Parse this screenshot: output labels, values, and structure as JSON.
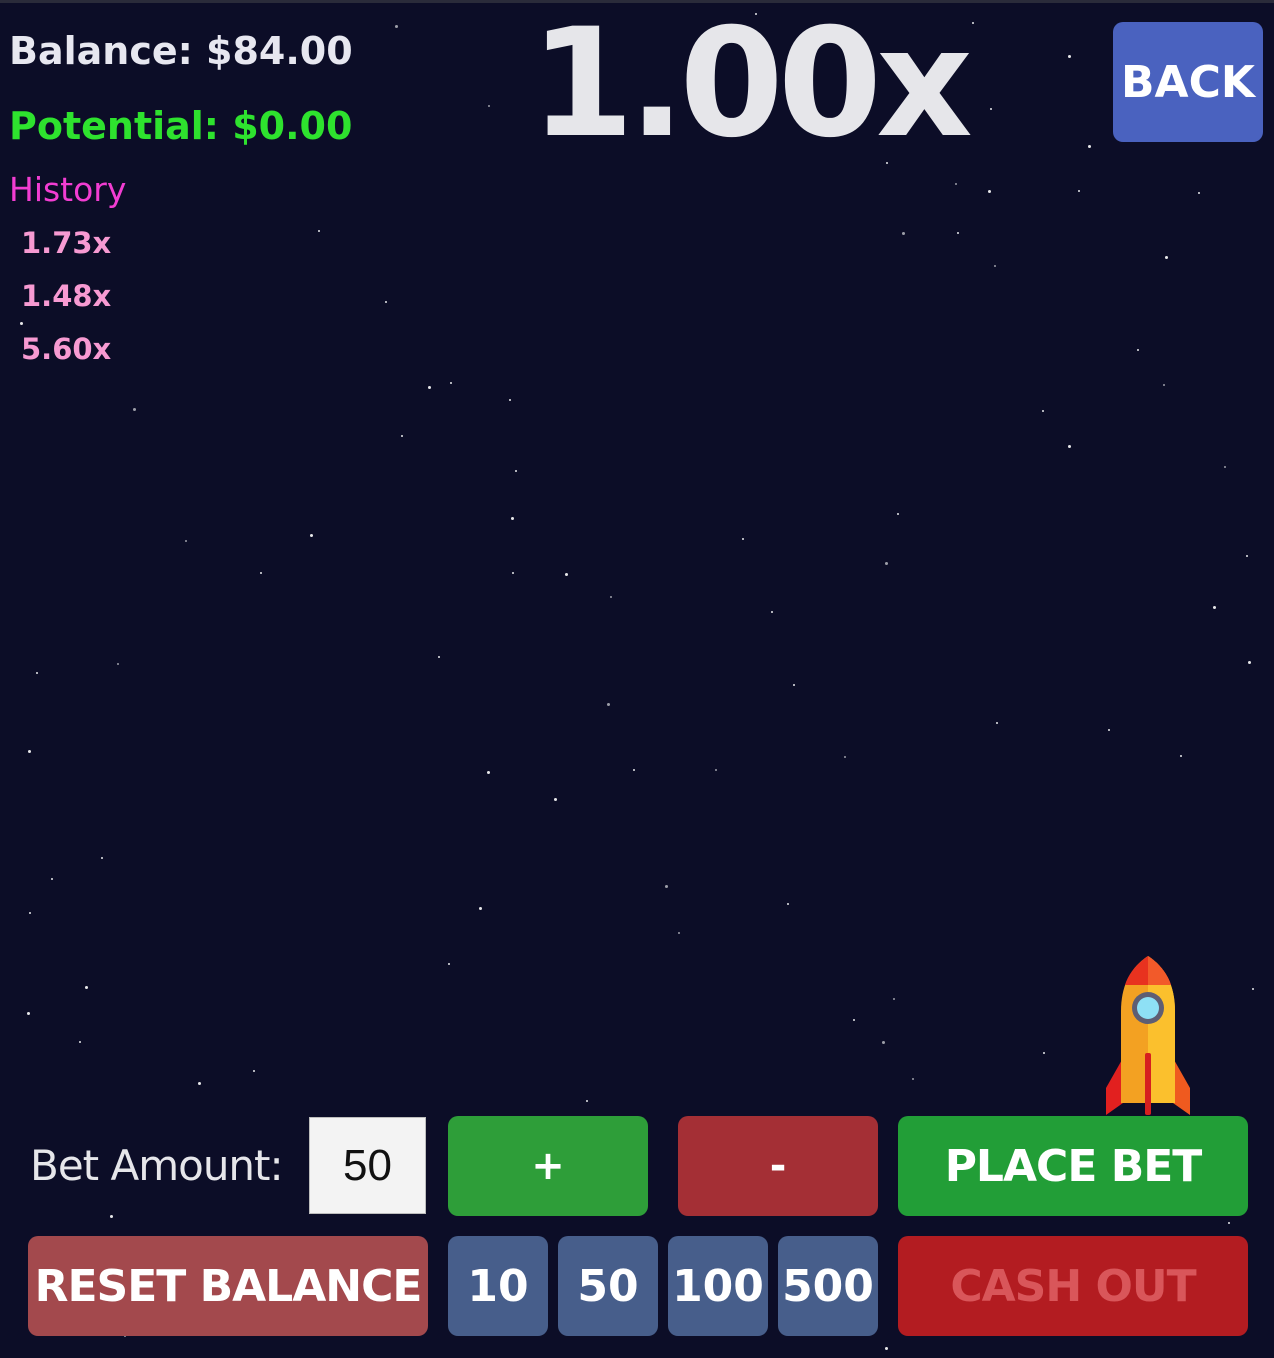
{
  "stats": {
    "balance": "Balance: $84.00",
    "potential": "Potential: $0.00"
  },
  "history": {
    "title": "History",
    "items": [
      "1.73x",
      "1.48x",
      "5.60x"
    ]
  },
  "game": {
    "multiplier": "1.00x",
    "rocket_icon": "rocket-icon"
  },
  "header": {
    "back_label": "BACK"
  },
  "controls": {
    "bet_label": "Bet Amount:",
    "bet_value": "50",
    "plus_label": "+",
    "minus_label": "-",
    "place_bet_label": "PLACE BET",
    "reset_label": "RESET BALANCE",
    "chips": [
      "10",
      "50",
      "100",
      "500"
    ],
    "cash_out_label": "CASH OUT"
  },
  "colors": {
    "background": "#0c0d27",
    "potential": "#2ee22e",
    "history_title": "#f23dd2",
    "history_items": "#f79ad2",
    "back_button": "#4a62bf",
    "plus_button": "#2e9e39",
    "minus_button": "#a42f35",
    "place_bet_button": "#229e37",
    "reset_button": "#a3494d",
    "chip_button": "#475e8b",
    "cash_out_button": "#b31c21"
  }
}
